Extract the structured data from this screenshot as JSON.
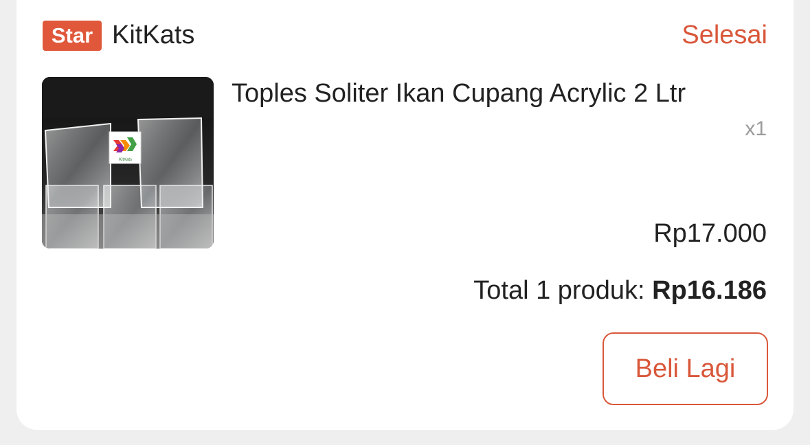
{
  "order": {
    "shop": {
      "badge": "Star",
      "name": "KitKats"
    },
    "status": "Selesai",
    "item": {
      "title": "Toples Soliter Ikan Cupang Acrylic 2 Ltr",
      "quantity": "x1",
      "price": "Rp17.000",
      "thumbnail_logo_text": "KitKats"
    },
    "total_label": "Total 1 produk:",
    "total_amount": "Rp16.186",
    "actions": {
      "buy_again": "Beli Lagi"
    }
  },
  "colors": {
    "accent": "#e0573a",
    "page_background": "#efefef",
    "card_background": "#ffffff"
  }
}
